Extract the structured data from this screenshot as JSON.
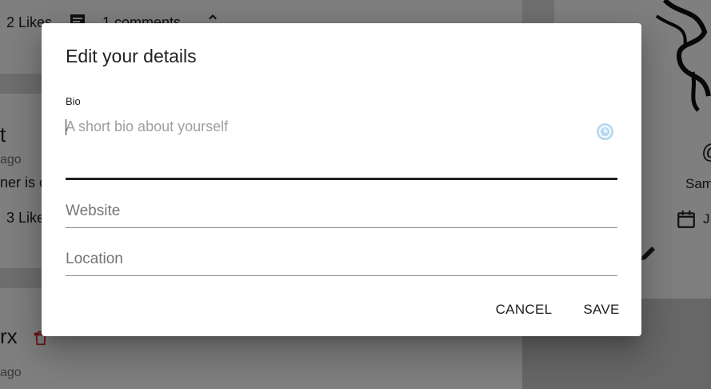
{
  "background": {
    "post1": {
      "likes": "2 Likes",
      "comments": "1 comments"
    },
    "post2": {
      "name_fragment": "t",
      "time_fragment": "ago",
      "body_fragment": "ner is c",
      "likes": "3 Like"
    },
    "post3": {
      "name_fragment": "rx",
      "time_fragment": "ago"
    },
    "profile": {
      "handle_fragment": "Sam",
      "joined_fragment": "J"
    }
  },
  "dialog": {
    "title": "Edit your details",
    "bio": {
      "label": "Bio",
      "value": "",
      "placeholder": "A short bio about yourself"
    },
    "website": {
      "value": "",
      "placeholder": "Website"
    },
    "location": {
      "value": "",
      "placeholder": "Location"
    },
    "cancel_label": "Cancel",
    "save_label": "Save"
  },
  "icons": {
    "comments": "comment-icon",
    "expand": "chevron-up-icon",
    "delete": "delete-icon",
    "edit": "pencil-icon",
    "calendar": "calendar-icon",
    "grammarly": "grammarly-icon"
  },
  "colors": {
    "backdrop": "rgba(0,0,0,0.5)",
    "delete_icon": "#d32f2f",
    "grammarly": "#8fc3e6"
  }
}
